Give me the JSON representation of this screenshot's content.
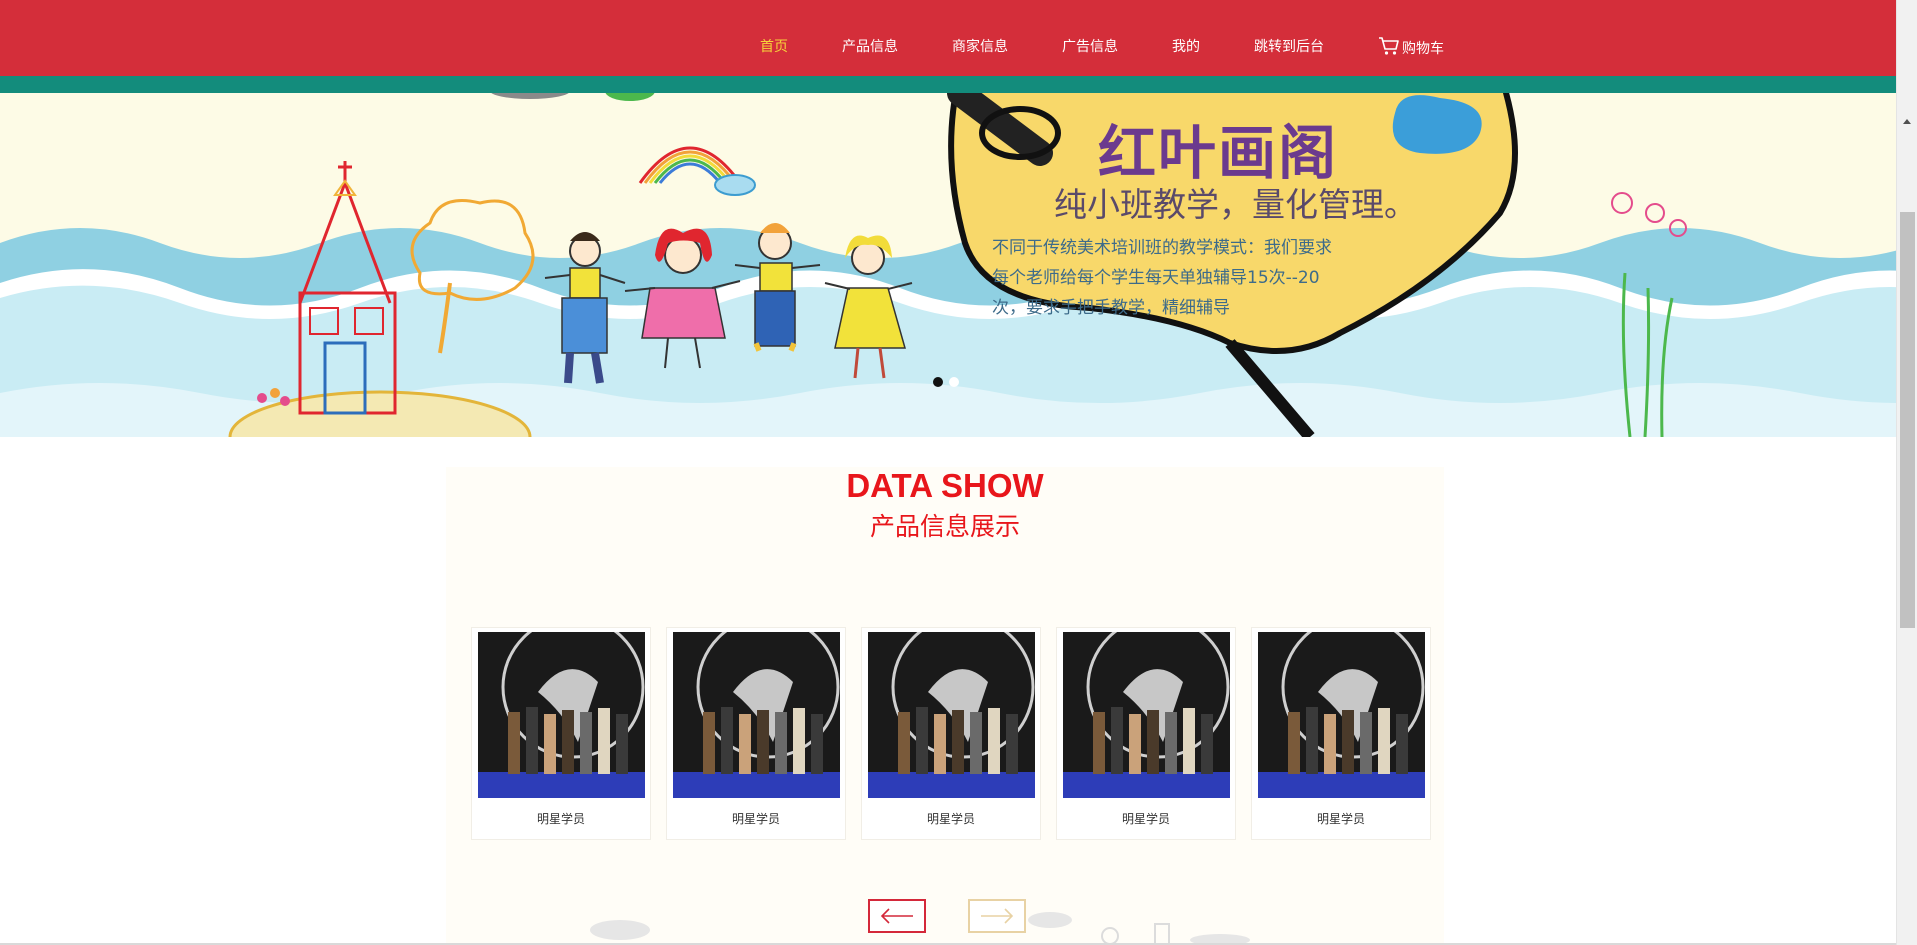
{
  "nav": {
    "items": [
      {
        "label": "首页",
        "active": true
      },
      {
        "label": "产品信息",
        "active": false
      },
      {
        "label": "商家信息",
        "active": false
      },
      {
        "label": "广告信息",
        "active": false
      },
      {
        "label": "我的",
        "active": false
      },
      {
        "label": "跳转到后台",
        "active": false
      }
    ],
    "cart": {
      "label": "购物车",
      "icon": "cart-icon"
    },
    "colors": {
      "bar": "#d42e3a",
      "strip": "#138c7c",
      "active_text": "#f6d23b"
    }
  },
  "banner": {
    "title": "红叶画阁",
    "subtitle": "纯小班教学，量化管理。",
    "description": "不同于传统美术培训班的教学模式：我们要求每个老师给每个学生每天单独辅导15次--20次，要求手把手教学，精细辅导",
    "slides": 2,
    "active_slide": 1
  },
  "show": {
    "title": "DATA SHOW",
    "subtitle": "产品信息展示",
    "cards": [
      {
        "caption": "明星学员"
      },
      {
        "caption": "明星学员"
      },
      {
        "caption": "明星学员"
      },
      {
        "caption": "明星学员"
      },
      {
        "caption": "明星学员"
      }
    ],
    "prev_icon": "arrow-left-icon",
    "next_icon": "arrow-right-icon"
  }
}
